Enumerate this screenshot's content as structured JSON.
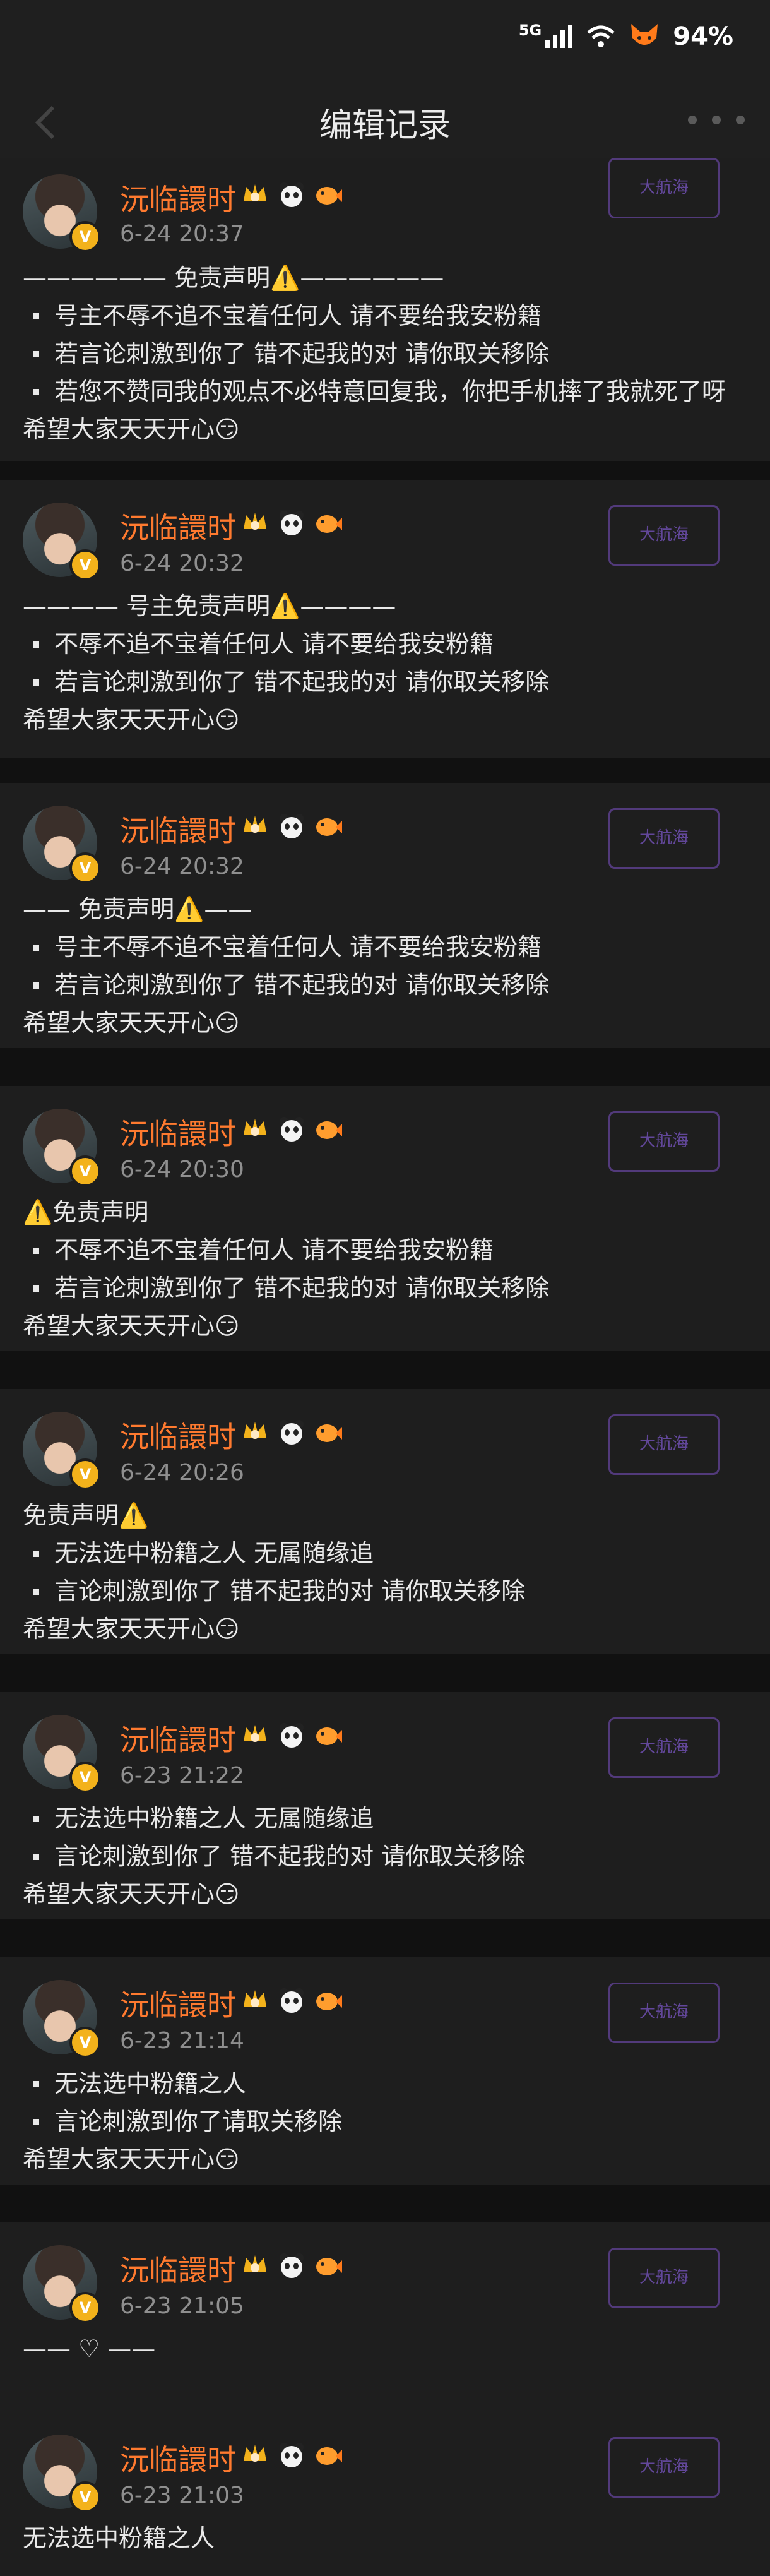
{
  "status_bar": {
    "signal": "5G",
    "battery": "94%"
  },
  "nav": {
    "title": "编辑记录"
  },
  "user": {
    "name": "沅临譞时",
    "verified_mark": "V",
    "stamp_text": "大航海"
  },
  "posts": [
    {
      "time": "6-24 20:37",
      "lines": [
        {
          "text": "—————— 免责声明⚠️——————",
          "bullet": false
        },
        {
          "text": "号主不辱不追不宝着任何人  请不要给我安粉籍",
          "bullet": true
        },
        {
          "text": "若言论刺激到你了 错不起我的对 请你取关移除",
          "bullet": true
        },
        {
          "text": "若您不赞同我的观点不必特意回复我，你把手机摔了我就死了呀",
          "bullet": true
        },
        {
          "text": "希望大家天天开心😏",
          "bullet": false
        }
      ]
    },
    {
      "time": "6-24 20:32",
      "lines": [
        {
          "text": "———— 号主免责声明⚠️————",
          "bullet": false
        },
        {
          "text": "不辱不追不宝着任何人  请不要给我安粉籍",
          "bullet": true
        },
        {
          "text": "若言论刺激到你了 错不起我的对 请你取关移除",
          "bullet": true
        },
        {
          "text": "希望大家天天开心😏",
          "bullet": false
        }
      ]
    },
    {
      "time": "6-24 20:32",
      "lines": [
        {
          "text": "—— 免责声明⚠️——",
          "bullet": false
        },
        {
          "text": "号主不辱不追不宝着任何人  请不要给我安粉籍",
          "bullet": true
        },
        {
          "text": "若言论刺激到你了 错不起我的对 请你取关移除",
          "bullet": true
        },
        {
          "text": "希望大家天天开心😏",
          "bullet": false
        }
      ]
    },
    {
      "time": "6-24 20:30",
      "lines": [
        {
          "text": "⚠️免责声明",
          "bullet": false
        },
        {
          "text": "不辱不追不宝着任何人  请不要给我安粉籍",
          "bullet": true
        },
        {
          "text": "若言论刺激到你了 错不起我的对 请你取关移除",
          "bullet": true
        },
        {
          "text": "希望大家天天开心😏",
          "bullet": false
        }
      ]
    },
    {
      "time": "6-24 20:26",
      "lines": [
        {
          "text": "免责声明⚠️",
          "bullet": false
        },
        {
          "text": "无法选中粉籍之人  无属随缘追",
          "bullet": true
        },
        {
          "text": "言论刺激到你了 错不起我的对 请你取关移除",
          "bullet": true
        },
        {
          "text": "希望大家天天开心😏",
          "bullet": false
        }
      ]
    },
    {
      "time": "6-23 21:22",
      "lines": [
        {
          "text": "无法选中粉籍之人  无属随缘追",
          "bullet": true
        },
        {
          "text": "言论刺激到你了 错不起我的对 请你取关移除",
          "bullet": true
        },
        {
          "text": "希望大家天天开心😏",
          "bullet": false
        }
      ]
    },
    {
      "time": "6-23 21:14",
      "lines": [
        {
          "text": "无法选中粉籍之人",
          "bullet": true
        },
        {
          "text": "言论刺激到你了请取关移除",
          "bullet": true
        },
        {
          "text": "希望大家天天开心😏",
          "bullet": false
        }
      ]
    },
    {
      "time": "6-23 21:05",
      "lines": [
        {
          "text": "—— ♡ ——",
          "bullet": false
        }
      ]
    },
    {
      "time": "6-23 21:03",
      "lines": [
        {
          "text": "无法选中粉籍之人",
          "bullet": false
        }
      ]
    }
  ]
}
